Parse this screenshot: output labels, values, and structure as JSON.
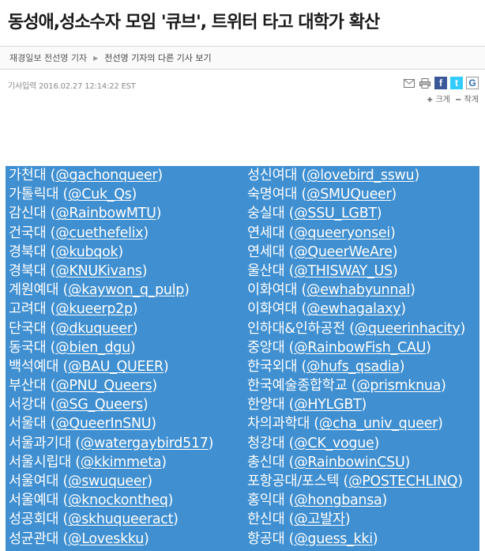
{
  "article": {
    "title": "동성애,성소수자 모임 '큐브', 트위터 타고 대학가 확산",
    "byline": "재경일보 전선영 기자",
    "more_articles": "전선영 기자의 다른 기사 보기",
    "date": "기사입력 2016.02.27 12:14:22 EST",
    "font_larger": "크게",
    "font_smaller": "작게"
  },
  "image_list": {
    "left": [
      {
        "school": "가천대",
        "handle": "@gachonqueer"
      },
      {
        "school": "가톨릭대",
        "handle": "@Cuk_Qs"
      },
      {
        "school": "감신대",
        "handle": "@RainbowMTU"
      },
      {
        "school": "건국대",
        "handle": "@cuethefelix"
      },
      {
        "school": "경북대",
        "handle": "@kubqok"
      },
      {
        "school": "경북대",
        "handle": "@KNUKivans"
      },
      {
        "school": "계원예대",
        "handle": "@kaywon_q_pulp"
      },
      {
        "school": "고려대",
        "handle": "@kueerp2p"
      },
      {
        "school": "단국대",
        "handle": "@dkuqueer"
      },
      {
        "school": "동국대",
        "handle": "@bien_dgu"
      },
      {
        "school": "백석예대",
        "handle": "@BAU_QUEER"
      },
      {
        "school": "부산대",
        "handle": "@PNU_Queers"
      },
      {
        "school": "서강대",
        "handle": "@SG_Queers"
      },
      {
        "school": "서울대",
        "handle": "@QueerInSNU"
      },
      {
        "school": "서울과기대",
        "handle": "@watergaybird517"
      },
      {
        "school": "서울시립대",
        "handle": "@kkimmeta"
      },
      {
        "school": "서울여대",
        "handle": "@swuqueer"
      },
      {
        "school": "서울예대",
        "handle": "@knockontheq"
      },
      {
        "school": "성공회대",
        "handle": "@skhuqueeract"
      },
      {
        "school": "성균관대",
        "handle": "@Loveskku"
      }
    ],
    "right": [
      {
        "school": "성신여대",
        "handle": "@lovebird_sswu"
      },
      {
        "school": "숙명여대",
        "handle": "@SMUQueer"
      },
      {
        "school": "숭실대",
        "handle": "@SSU_LGBT"
      },
      {
        "school": "연세대",
        "handle": "@queeryonsei"
      },
      {
        "school": "연세대",
        "handle": "@QueerWeAre"
      },
      {
        "school": "울산대",
        "handle": "@THISWAY_US"
      },
      {
        "school": "이화여대",
        "handle": "@ewhabyunnal"
      },
      {
        "school": "이화여대",
        "handle": "@ewhagalaxy"
      },
      {
        "school": "인하대&인하공전",
        "handle": "@queerinhacity"
      },
      {
        "school": "중앙대",
        "handle": "@RainbowFish_CAU"
      },
      {
        "school": "한국외대",
        "handle": "@hufs_qsadia"
      },
      {
        "school": "한국예술종합학교",
        "handle": "@prismknua"
      },
      {
        "school": "한양대",
        "handle": "@HYLGBT"
      },
      {
        "school": "차의과학대",
        "handle": "@cha_univ_queer"
      },
      {
        "school": "청강대",
        "handle": "@CK_vogue"
      },
      {
        "school": "총신대",
        "handle": "@RainbowinCSU"
      },
      {
        "school": "포항공대/포스텍",
        "handle": "@POSTECHLINQ"
      },
      {
        "school": "홍익대",
        "handle": "@hongbansa"
      },
      {
        "school": "한신대",
        "handle": "@고발자"
      },
      {
        "school": "항공대",
        "handle": "@guess_kki"
      }
    ]
  },
  "colors": {
    "image_background": "#3f8fd1",
    "facebook": "#3b5998",
    "twitter": "#33ccff"
  }
}
